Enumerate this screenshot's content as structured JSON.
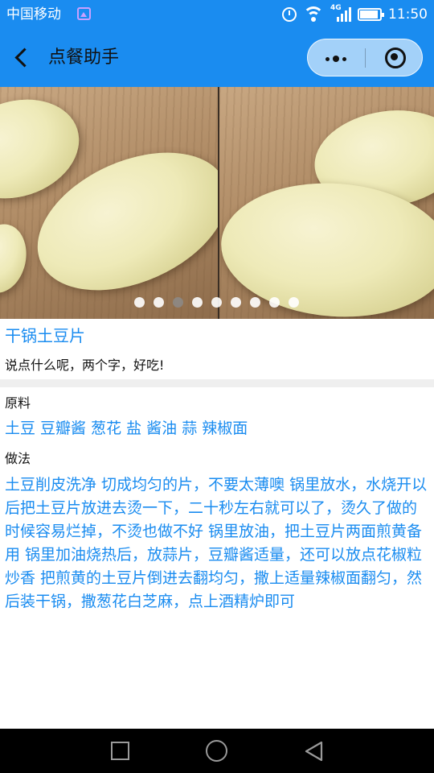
{
  "status_bar": {
    "carrier": "中国移动",
    "network": "4G",
    "time": "11:50"
  },
  "nav": {
    "title": "点餐助手"
  },
  "carousel": {
    "slide_count": 9,
    "active_index": 2
  },
  "dish": {
    "name": "干锅土豆片",
    "description": "说点什么呢，两个字，好吃!"
  },
  "ingredients": {
    "label": "原料",
    "text": "土豆 豆瓣酱 葱花 盐 酱油 蒜 辣椒面"
  },
  "method": {
    "label": "做法",
    "text": "土豆削皮洗净 切成均匀的片，不要太薄噢 锅里放水，水烧开以后把土豆片放进去烫一下，二十秒左右就可以了，烫久了做的时候容易烂掉，不烫也做不好 锅里放油，把土豆片两面煎黄备用 锅里加油烧热后，放蒜片，豆瓣酱适量，还可以放点花椒粒炒香 把煎黄的土豆片倒进去翻均匀，撒上适量辣椒面翻匀，然后装干锅，撒葱花白芝麻，点上酒精炉即可"
  },
  "colors": {
    "accent": "#1a8cf0",
    "text": "#111111",
    "separator": "#efefef"
  },
  "icons": [
    "back-arrow-icon",
    "more-dots-icon",
    "close-target-icon",
    "alarm-icon",
    "wifi-icon",
    "signal-icon",
    "battery-icon",
    "gallery-icon",
    "square-nav-icon",
    "circle-nav-icon",
    "triangle-nav-icon"
  ]
}
